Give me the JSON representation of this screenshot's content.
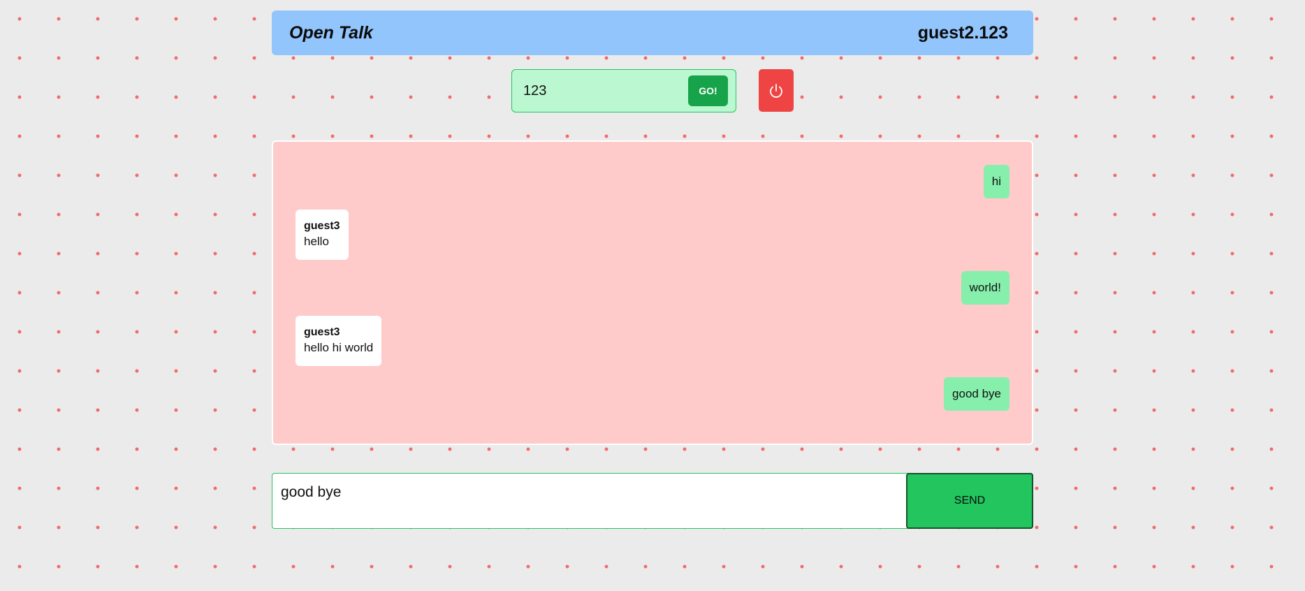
{
  "header": {
    "title": "Open Talk",
    "user": "guest2.123"
  },
  "room": {
    "value": "123",
    "go_label": "GO!",
    "power_icon": "power-icon"
  },
  "messages": [
    {
      "own": true,
      "text": "hi"
    },
    {
      "own": false,
      "sender": "guest3",
      "text": "hello"
    },
    {
      "own": true,
      "text": "world!"
    },
    {
      "own": false,
      "sender": "guest3",
      "text": "hello hi world"
    },
    {
      "own": true,
      "text": "good bye"
    }
  ],
  "composer": {
    "value": "good bye",
    "send_label": "SEND"
  },
  "colors": {
    "background": "#ebebeb",
    "dots": "#f26b6b",
    "header": "#93c5fd",
    "room_box": "#bbf7d0",
    "go_button": "#16a34a",
    "power_button": "#ef4444",
    "chat_panel": "#fecaca",
    "own_bubble": "#86efac",
    "other_bubble": "#ffffff",
    "send_button": "#22c55e"
  }
}
